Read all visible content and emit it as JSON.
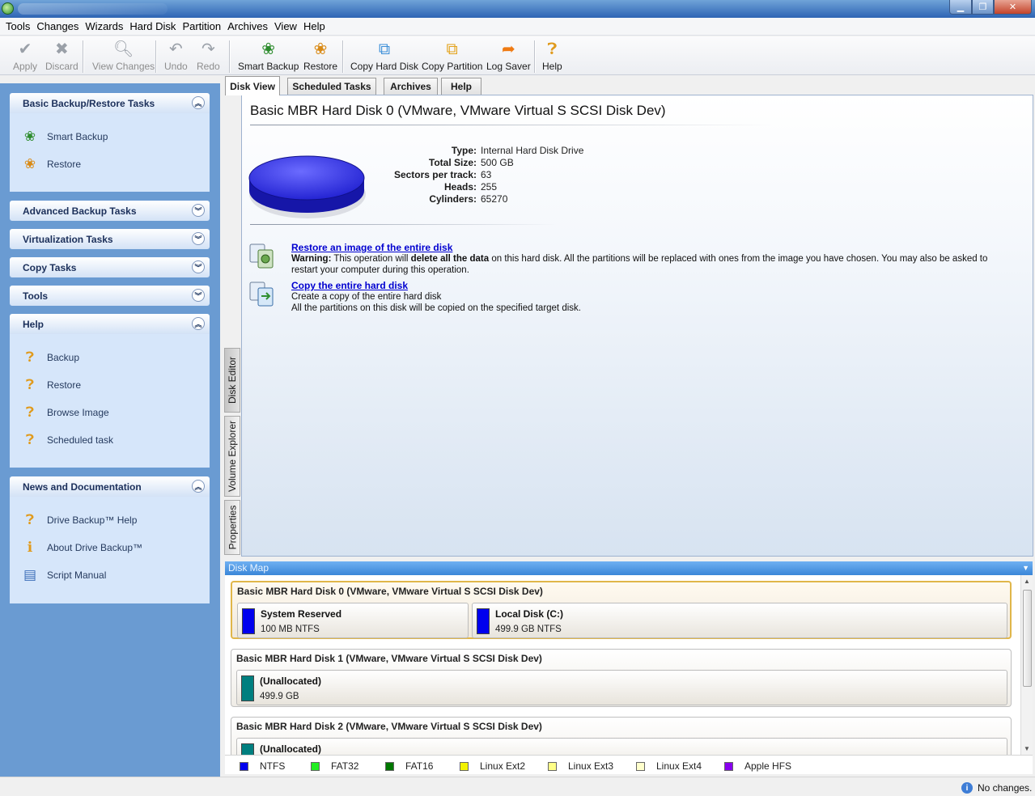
{
  "menubar": [
    "Tools",
    "Changes",
    "Wizards",
    "Hard Disk",
    "Partition",
    "Archives",
    "View",
    "Help"
  ],
  "toolbar": {
    "apply": "Apply",
    "discard": "Discard",
    "view_changes": "View Changes",
    "undo": "Undo",
    "redo": "Redo",
    "smart_backup": "Smart Backup",
    "restore": "Restore",
    "copy_hard_disk": "Copy Hard Disk",
    "copy_partition": "Copy Partition",
    "log_saver": "Log Saver",
    "help": "Help"
  },
  "taskpane": {
    "basic": {
      "title": "Basic Backup/Restore Tasks",
      "items": [
        "Smart Backup",
        "Restore"
      ]
    },
    "advanced": "Advanced Backup Tasks",
    "virtualization": "Virtualization Tasks",
    "copy": "Copy Tasks",
    "tools": "Tools",
    "help": {
      "title": "Help",
      "items": [
        "Backup",
        "Restore",
        "Browse Image",
        "Scheduled task"
      ]
    },
    "news": {
      "title": "News and Documentation",
      "items": [
        "Drive Backup™ Help",
        "About Drive Backup™",
        "Script Manual"
      ]
    }
  },
  "tabs": [
    "Disk View",
    "Scheduled Tasks",
    "Archives",
    "Help"
  ],
  "side_tabs": [
    "Disk Editor",
    "Volume Explorer",
    "Properties"
  ],
  "disk": {
    "title": "Basic MBR Hard Disk 0 (VMware, VMware Virtual S SCSI Disk Dev)",
    "props": [
      {
        "key": "Type:",
        "value": "Internal Hard Disk Drive"
      },
      {
        "key": "Total Size:",
        "value": "500 GB"
      },
      {
        "key": "Sectors per track:",
        "value": "63"
      },
      {
        "key": "Heads:",
        "value": "255"
      },
      {
        "key": "Cylinders:",
        "value": "65270"
      }
    ]
  },
  "ops": {
    "restore": {
      "link": "Restore an image of the entire disk",
      "warn_label": "Warning:",
      "warn_a": " This operation will ",
      "warn_bold": "delete all the data",
      "warn_b": " on this hard disk. All the partitions will be replaced with ones from the image you have chosen. You may also be asked to restart your computer during this operation."
    },
    "copy": {
      "link": "Copy the entire hard disk",
      "line1": "Create a copy of the entire hard disk",
      "line2": "All the partitions on this disk will be copied on the specified target disk."
    }
  },
  "diskmap": {
    "header": "Disk Map",
    "disks": [
      {
        "title": "Basic MBR Hard Disk 0 (VMware, VMware Virtual S SCSI Disk Dev)",
        "parts": [
          {
            "name": "System Reserved",
            "info": "100 MB NTFS"
          },
          {
            "name": "Local Disk (C:)",
            "info": "499.9 GB NTFS"
          }
        ]
      },
      {
        "title": "Basic MBR Hard Disk 1 (VMware, VMware Virtual S SCSI Disk Dev)",
        "parts": [
          {
            "name": "(Unallocated)",
            "info": "499.9 GB"
          }
        ]
      },
      {
        "title": "Basic MBR Hard Disk 2 (VMware, VMware Virtual S SCSI Disk Dev)",
        "parts": [
          {
            "name": "(Unallocated)",
            "info": ""
          }
        ]
      }
    ]
  },
  "legend": [
    {
      "label": "NTFS",
      "color": "#0000ee"
    },
    {
      "label": "FAT32",
      "color": "#22ee22"
    },
    {
      "label": "FAT16",
      "color": "#007700"
    },
    {
      "label": "Linux Ext2",
      "color": "#f2f200"
    },
    {
      "label": "Linux Ext3",
      "color": "#ffff88"
    },
    {
      "label": "Linux Ext4",
      "color": "#ffffcc"
    },
    {
      "label": "Apple HFS",
      "color": "#8800ee"
    }
  ],
  "colors": {
    "ntfs_bar": "#0000ee",
    "unallocated_bar": "#007f7f",
    "link": "#0000d0",
    "selected_border": "#e0b64a"
  },
  "status": "No changes."
}
